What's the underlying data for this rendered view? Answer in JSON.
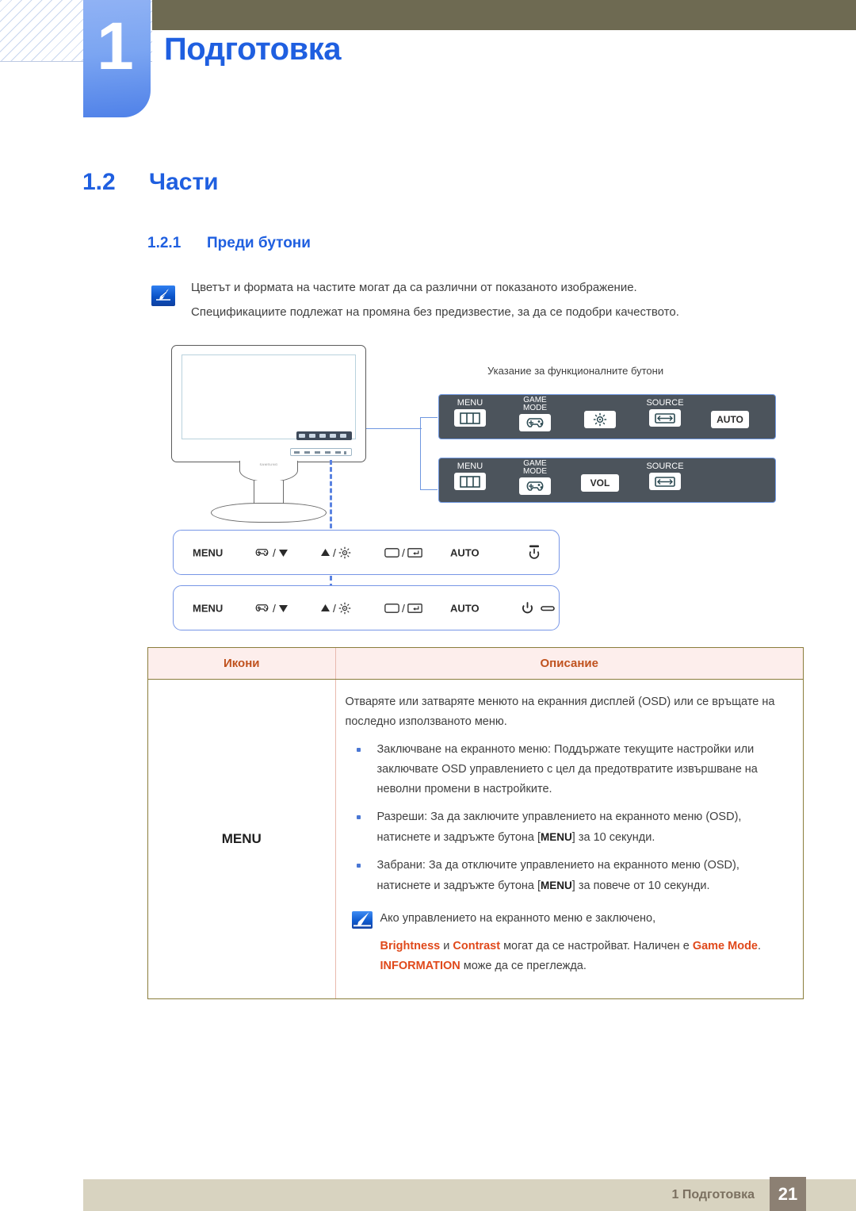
{
  "header": {
    "chapter_number": "1",
    "chapter_title": "Подготовка"
  },
  "headings": {
    "section_number": "1.2",
    "section_title": "Части",
    "subsection_number": "1.2.1",
    "subsection_title": "Преди бутони"
  },
  "note": {
    "icon": "note-pencil-icon",
    "line1": "Цветът и формата на частите могат да са различни от показаното изображение.",
    "line2": "Спецификациите подлежат на промяна без предизвестие, за да се подобри качеството."
  },
  "diagram": {
    "osd_caption": "Указание за функционалните бутони",
    "osd_bar_1": [
      {
        "label": "MENU",
        "icon": "menu-panel-icon",
        "glyph": ""
      },
      {
        "label": "GAME\nMODE",
        "icon": "gamepad-icon",
        "glyph": ""
      },
      {
        "label": "",
        "icon": "brightness-icon",
        "glyph": ""
      },
      {
        "label": "SOURCE",
        "icon": "source-icon",
        "glyph": ""
      },
      {
        "label": "",
        "icon": "auto-key-icon",
        "glyph": "AUTO"
      }
    ],
    "osd_bar_2": [
      {
        "label": "MENU",
        "icon": "menu-panel-icon",
        "glyph": ""
      },
      {
        "label": "GAME\nMODE",
        "icon": "gamepad-icon",
        "glyph": ""
      },
      {
        "label": "",
        "icon": "volume-key-icon",
        "glyph": "VOL"
      },
      {
        "label": "SOURCE",
        "icon": "source-icon",
        "glyph": ""
      }
    ],
    "front_bar_1": {
      "menu": "MENU",
      "auto": "AUTO",
      "icons": [
        "gamepad-icon",
        "down-triangle-icon",
        "up-triangle-icon",
        "brightness-icon",
        "display-icon",
        "enter-icon",
        "power-standby-icon"
      ]
    },
    "front_bar_2": {
      "menu": "MENU",
      "auto": "AUTO",
      "icons": [
        "gamepad-icon",
        "down-triangle-icon",
        "up-triangle-icon",
        "brightness-icon",
        "display-icon",
        "enter-icon",
        "power-icon",
        "led-indicator-icon"
      ]
    }
  },
  "table": {
    "headers": {
      "icons": "Икони",
      "description": "Описание"
    },
    "row": {
      "icon_label": "MENU",
      "intro": "Отваряте или затваряте менюто на екранния дисплей (OSD) или се връщате на последно използваното меню.",
      "bullets": [
        "Заключване на екранното меню: Поддържате текущите настройки или заключвате OSD управлението с цел да предотвратите извършване на неволни промени в настройките.",
        "Разреши: За да заключите управлението на екранното меню (OSD), натиснете и задръжте бутона [MENU] за 10 секунди.",
        "Забрани: За да отключите управлението на екранното меню (OSD), натиснете и задръжте бутона [MENU] за повече от 10 секунди."
      ],
      "bullet2_prefix": "Разреши: За да заключите управлението на екранното меню (OSD), натиснете и задръжте бутона [",
      "bullet2_key": "MENU",
      "bullet2_suffix": "] за 10 секунди.",
      "bullet3_prefix": "Забрани: За да отключите управлението на екранното меню (OSD), натиснете и задръжте бутона [",
      "bullet3_key": "MENU",
      "bullet3_suffix": "] за повече от 10 секунди.",
      "subnote": {
        "icon": "note-pencil-icon",
        "line1": "Ако управлението на екранното меню е заключено,",
        "term1": "Brightness",
        "mid1": " и ",
        "term2": "Contrast",
        "mid2": " могат да се настройват. Наличен е ",
        "term3": "Game Mode",
        "mid3": ". ",
        "term4": "INFORMATION",
        "mid4": " може да се преглежда."
      }
    }
  },
  "footer": {
    "text": "1 Подготовка",
    "page": "21"
  },
  "colors": {
    "accent_blue": "#1f5fe0",
    "olive": "#6e6a52",
    "orange": "#e0491b",
    "table_header_bg": "#fdeeec",
    "table_header_text": "#c0521e",
    "footer_bar": "#d8d3c0",
    "page_box": "#8c8073",
    "osd_bar": "#4c545c"
  }
}
